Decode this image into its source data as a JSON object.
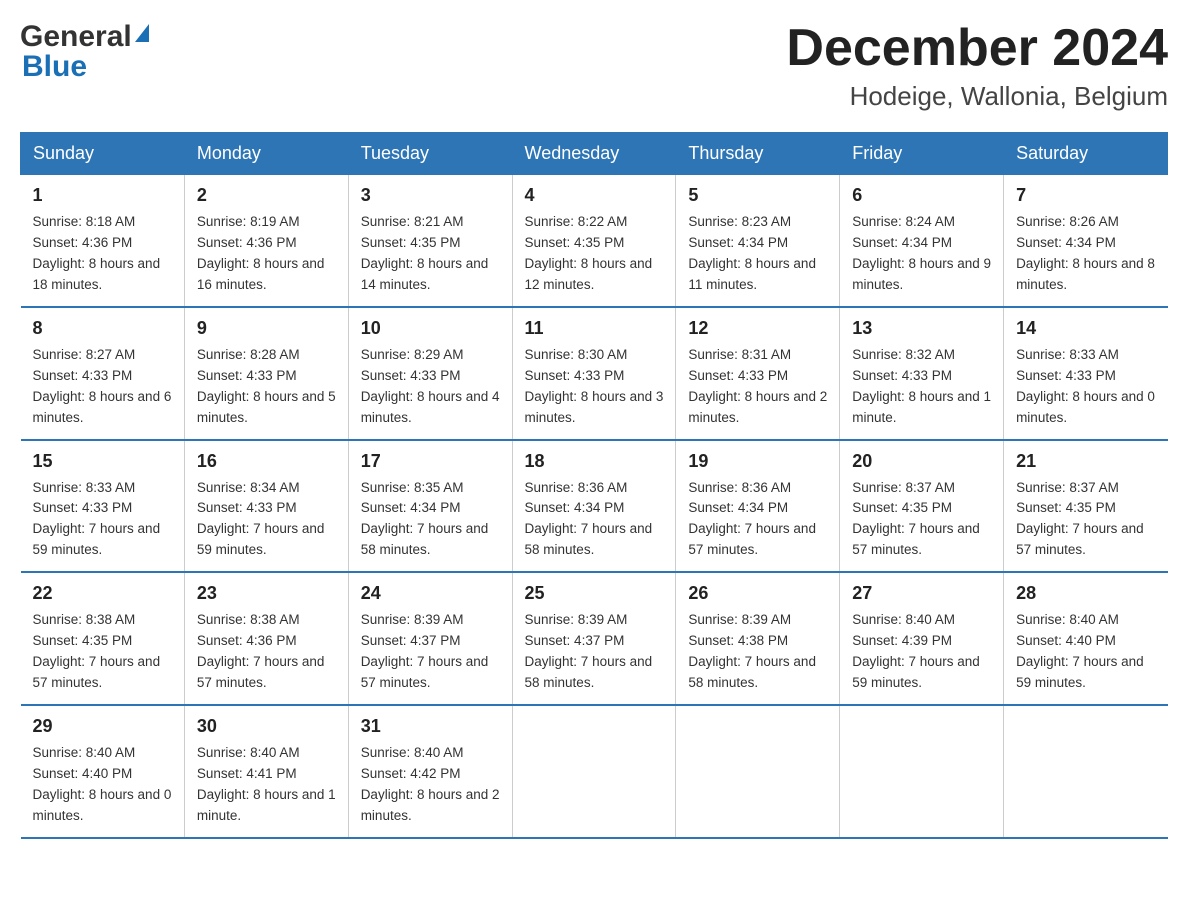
{
  "header": {
    "logo_general": "General",
    "logo_blue": "Blue",
    "month_title": "December 2024",
    "location": "Hodeige, Wallonia, Belgium"
  },
  "days_of_week": [
    "Sunday",
    "Monday",
    "Tuesday",
    "Wednesday",
    "Thursday",
    "Friday",
    "Saturday"
  ],
  "weeks": [
    [
      {
        "num": "1",
        "sunrise": "8:18 AM",
        "sunset": "4:36 PM",
        "daylight": "8 hours and 18 minutes."
      },
      {
        "num": "2",
        "sunrise": "8:19 AM",
        "sunset": "4:36 PM",
        "daylight": "8 hours and 16 minutes."
      },
      {
        "num": "3",
        "sunrise": "8:21 AM",
        "sunset": "4:35 PM",
        "daylight": "8 hours and 14 minutes."
      },
      {
        "num": "4",
        "sunrise": "8:22 AM",
        "sunset": "4:35 PM",
        "daylight": "8 hours and 12 minutes."
      },
      {
        "num": "5",
        "sunrise": "8:23 AM",
        "sunset": "4:34 PM",
        "daylight": "8 hours and 11 minutes."
      },
      {
        "num": "6",
        "sunrise": "8:24 AM",
        "sunset": "4:34 PM",
        "daylight": "8 hours and 9 minutes."
      },
      {
        "num": "7",
        "sunrise": "8:26 AM",
        "sunset": "4:34 PM",
        "daylight": "8 hours and 8 minutes."
      }
    ],
    [
      {
        "num": "8",
        "sunrise": "8:27 AM",
        "sunset": "4:33 PM",
        "daylight": "8 hours and 6 minutes."
      },
      {
        "num": "9",
        "sunrise": "8:28 AM",
        "sunset": "4:33 PM",
        "daylight": "8 hours and 5 minutes."
      },
      {
        "num": "10",
        "sunrise": "8:29 AM",
        "sunset": "4:33 PM",
        "daylight": "8 hours and 4 minutes."
      },
      {
        "num": "11",
        "sunrise": "8:30 AM",
        "sunset": "4:33 PM",
        "daylight": "8 hours and 3 minutes."
      },
      {
        "num": "12",
        "sunrise": "8:31 AM",
        "sunset": "4:33 PM",
        "daylight": "8 hours and 2 minutes."
      },
      {
        "num": "13",
        "sunrise": "8:32 AM",
        "sunset": "4:33 PM",
        "daylight": "8 hours and 1 minute."
      },
      {
        "num": "14",
        "sunrise": "8:33 AM",
        "sunset": "4:33 PM",
        "daylight": "8 hours and 0 minutes."
      }
    ],
    [
      {
        "num": "15",
        "sunrise": "8:33 AM",
        "sunset": "4:33 PM",
        "daylight": "7 hours and 59 minutes."
      },
      {
        "num": "16",
        "sunrise": "8:34 AM",
        "sunset": "4:33 PM",
        "daylight": "7 hours and 59 minutes."
      },
      {
        "num": "17",
        "sunrise": "8:35 AM",
        "sunset": "4:34 PM",
        "daylight": "7 hours and 58 minutes."
      },
      {
        "num": "18",
        "sunrise": "8:36 AM",
        "sunset": "4:34 PM",
        "daylight": "7 hours and 58 minutes."
      },
      {
        "num": "19",
        "sunrise": "8:36 AM",
        "sunset": "4:34 PM",
        "daylight": "7 hours and 57 minutes."
      },
      {
        "num": "20",
        "sunrise": "8:37 AM",
        "sunset": "4:35 PM",
        "daylight": "7 hours and 57 minutes."
      },
      {
        "num": "21",
        "sunrise": "8:37 AM",
        "sunset": "4:35 PM",
        "daylight": "7 hours and 57 minutes."
      }
    ],
    [
      {
        "num": "22",
        "sunrise": "8:38 AM",
        "sunset": "4:35 PM",
        "daylight": "7 hours and 57 minutes."
      },
      {
        "num": "23",
        "sunrise": "8:38 AM",
        "sunset": "4:36 PM",
        "daylight": "7 hours and 57 minutes."
      },
      {
        "num": "24",
        "sunrise": "8:39 AM",
        "sunset": "4:37 PM",
        "daylight": "7 hours and 57 minutes."
      },
      {
        "num": "25",
        "sunrise": "8:39 AM",
        "sunset": "4:37 PM",
        "daylight": "7 hours and 58 minutes."
      },
      {
        "num": "26",
        "sunrise": "8:39 AM",
        "sunset": "4:38 PM",
        "daylight": "7 hours and 58 minutes."
      },
      {
        "num": "27",
        "sunrise": "8:40 AM",
        "sunset": "4:39 PM",
        "daylight": "7 hours and 59 minutes."
      },
      {
        "num": "28",
        "sunrise": "8:40 AM",
        "sunset": "4:40 PM",
        "daylight": "7 hours and 59 minutes."
      }
    ],
    [
      {
        "num": "29",
        "sunrise": "8:40 AM",
        "sunset": "4:40 PM",
        "daylight": "8 hours and 0 minutes."
      },
      {
        "num": "30",
        "sunrise": "8:40 AM",
        "sunset": "4:41 PM",
        "daylight": "8 hours and 1 minute."
      },
      {
        "num": "31",
        "sunrise": "8:40 AM",
        "sunset": "4:42 PM",
        "daylight": "8 hours and 2 minutes."
      },
      null,
      null,
      null,
      null
    ]
  ]
}
